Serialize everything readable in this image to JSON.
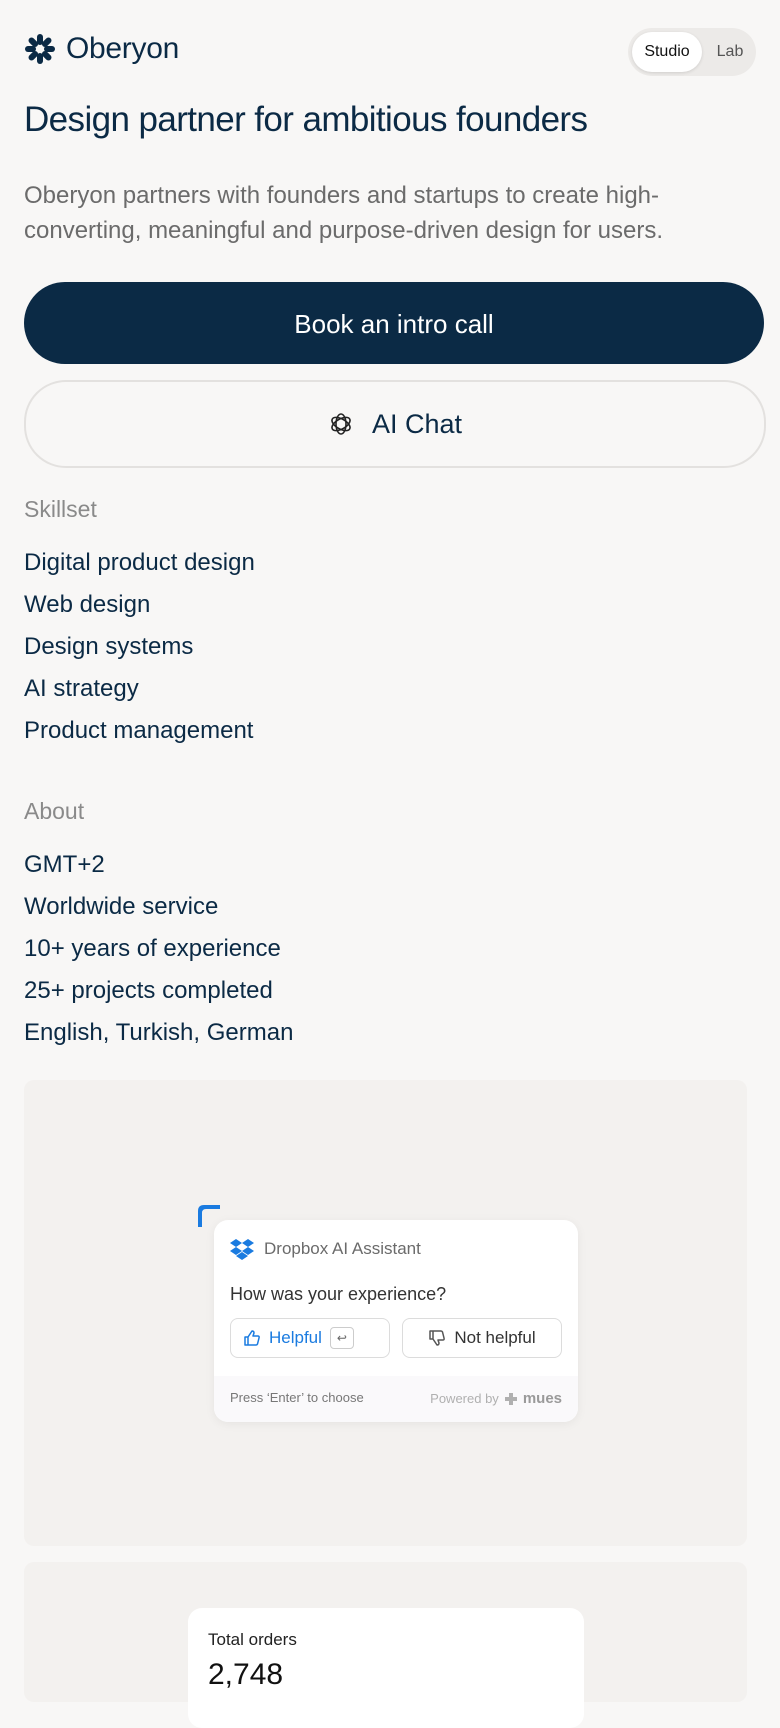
{
  "header": {
    "brand": "Oberyon",
    "toggle": {
      "active": "Studio",
      "inactive": "Lab"
    }
  },
  "hero": {
    "headline": "Design partner for ambitious founders",
    "intro": "Oberyon partners with founders and startups to create high-converting, meaningful and purpose-driven design for users."
  },
  "actions": {
    "primary": "Book an intro call",
    "secondary": "AI Chat"
  },
  "skillset": {
    "title": "Skillset",
    "items": [
      "Digital product design",
      "Web design",
      "Design systems",
      "AI strategy",
      "Product management"
    ]
  },
  "about": {
    "title": "About",
    "items": [
      "GMT+2",
      "Worldwide service",
      "10+ years of experience",
      "25+ projects completed",
      "English, Turkish, German"
    ]
  },
  "feedback_widget": {
    "app_name": "Dropbox AI Assistant",
    "question": "How was your experience?",
    "helpful": "Helpful",
    "enter_key": "↩",
    "not_helpful": "Not helpful",
    "hint": "Press ‘Enter’ to choose",
    "powered_by": "Powered by",
    "brand": "mues"
  },
  "orders_widget": {
    "label": "Total orders",
    "value": "2,748"
  },
  "colors": {
    "primary": "#0b2a45",
    "background": "#f8f7f6",
    "accent_blue": "#1a7be0"
  }
}
